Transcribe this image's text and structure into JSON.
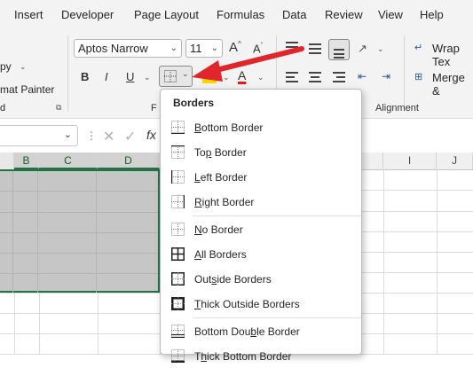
{
  "menu": {
    "items": [
      "Insert",
      "Developer",
      "Page Layout",
      "Formulas",
      "Data",
      "Review",
      "View",
      "Help"
    ]
  },
  "ribbon": {
    "clipboard": {
      "copy_partial": "py",
      "format_painter_partial": "mat Painter",
      "group_label_partial": "d"
    },
    "font": {
      "font_name": "Aptos Narrow",
      "font_size": "11",
      "grow_label": "A",
      "shrink_label": "A",
      "bold": "B",
      "italic": "I",
      "underline": "U",
      "font_color_label": "A",
      "group_label_partial": "F",
      "highlight_color": "#ffd400",
      "font_color": "#e01b1b"
    },
    "alignment": {
      "wrap_text_partial": "Wrap Tex",
      "merge_partial": "Merge &",
      "group_label": "Alignment"
    }
  },
  "formula_bar": {
    "fx": "fx"
  },
  "columns": [
    {
      "label": "B",
      "selected": true
    },
    {
      "label": "C",
      "selected": true
    },
    {
      "label": "D",
      "selected": true
    },
    {
      "label": "I",
      "selected": false
    },
    {
      "label": "J",
      "selected": false
    }
  ],
  "borders_menu": {
    "title": "Borders",
    "items": [
      {
        "label": "Bottom Border",
        "accel": "B",
        "rest": "ottom Border",
        "icon": "bottom-border-icon"
      },
      {
        "label": "Top Border",
        "accel_pre": "To",
        "accel": "p",
        "rest": " Border",
        "icon": "top-border-icon"
      },
      {
        "label": "Left Border",
        "accel": "L",
        "rest": "eft Border",
        "icon": "left-border-icon"
      },
      {
        "label": "Right Border",
        "accel": "R",
        "rest": "ight Border",
        "icon": "right-border-icon"
      },
      {
        "label": "No Border",
        "accel": "N",
        "rest": "o Border",
        "icon": "no-border-icon"
      },
      {
        "label": "All Borders",
        "accel": "A",
        "rest": "ll Borders",
        "icon": "all-borders-icon"
      },
      {
        "label": "Outside Borders",
        "accel_pre": "Out",
        "accel": "s",
        "rest": "ide Borders",
        "icon": "outside-borders-icon"
      },
      {
        "label": "Thick Outside Borders",
        "accel": "T",
        "rest": "hick Outside Borders",
        "icon": "thick-outside-borders-icon"
      },
      {
        "label": "Bottom Double Border",
        "accel_pre": "Bottom Dou",
        "accel": "b",
        "rest": "le Border",
        "icon": "bottom-double-border-icon"
      },
      {
        "label": "Thick Bottom Border",
        "accel_pre": "T",
        "accel": "h",
        "rest": "ick Bottom Border",
        "icon": "thick-bottom-border-icon"
      }
    ]
  },
  "colors": {
    "accent_green": "#217346",
    "arrow_red": "#e0262b",
    "selection_gray": "#c6c6c6"
  }
}
